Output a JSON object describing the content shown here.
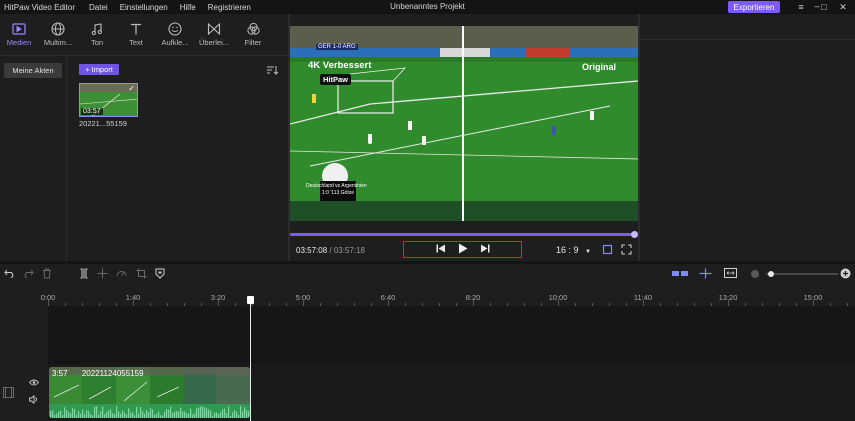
{
  "titlebar": {
    "app_title": "HitPaw Video Editor",
    "menu": [
      "Datei",
      "Einstellungen",
      "Hilfe",
      "Registrieren"
    ],
    "project_title": "Unbenanntes Projekt",
    "export_label": "Exportieren"
  },
  "tabs": [
    {
      "label": "Medien",
      "icon": "play-square-icon"
    },
    {
      "label": "Multim...",
      "icon": "globe-icon"
    },
    {
      "label": "Ton",
      "icon": "music-note-icon"
    },
    {
      "label": "Text",
      "icon": "text-T-icon"
    },
    {
      "label": "Aufkle...",
      "icon": "smiley-icon"
    },
    {
      "label": "Überlei...",
      "icon": "transition-bowtie-icon"
    },
    {
      "label": "Filter",
      "icon": "filter-circles-icon"
    }
  ],
  "media": {
    "folder_label": "Meine Akten",
    "import_label": "+ Import",
    "clip_duration": "03:57",
    "clip_name": "20221...55159"
  },
  "preview": {
    "label_left": "4K Verbessert",
    "label_right": "Original",
    "watermark": "HitPaw",
    "scoreboard": "GER 1-0 ARG",
    "caption_line1": "Deutschland vs Argentinien",
    "caption_line2": "1:0 '113 Götze",
    "progress": 1.0,
    "current_time": "03:57:08",
    "total_time": "03:57:18",
    "ratio": "16 : 9"
  },
  "timeline": {
    "ticks": [
      "0:00",
      "1:40",
      "3:20",
      "5:00",
      "6:40",
      "8:20",
      "10:00",
      "11:40",
      "13:20",
      "15:00"
    ],
    "clip_duration": "3:57",
    "clip_name": "20221124055159"
  },
  "colors": {
    "accent": "#7d5cf6",
    "highlight_box": "#e02424",
    "pitch_green": "#2e8a2a"
  }
}
